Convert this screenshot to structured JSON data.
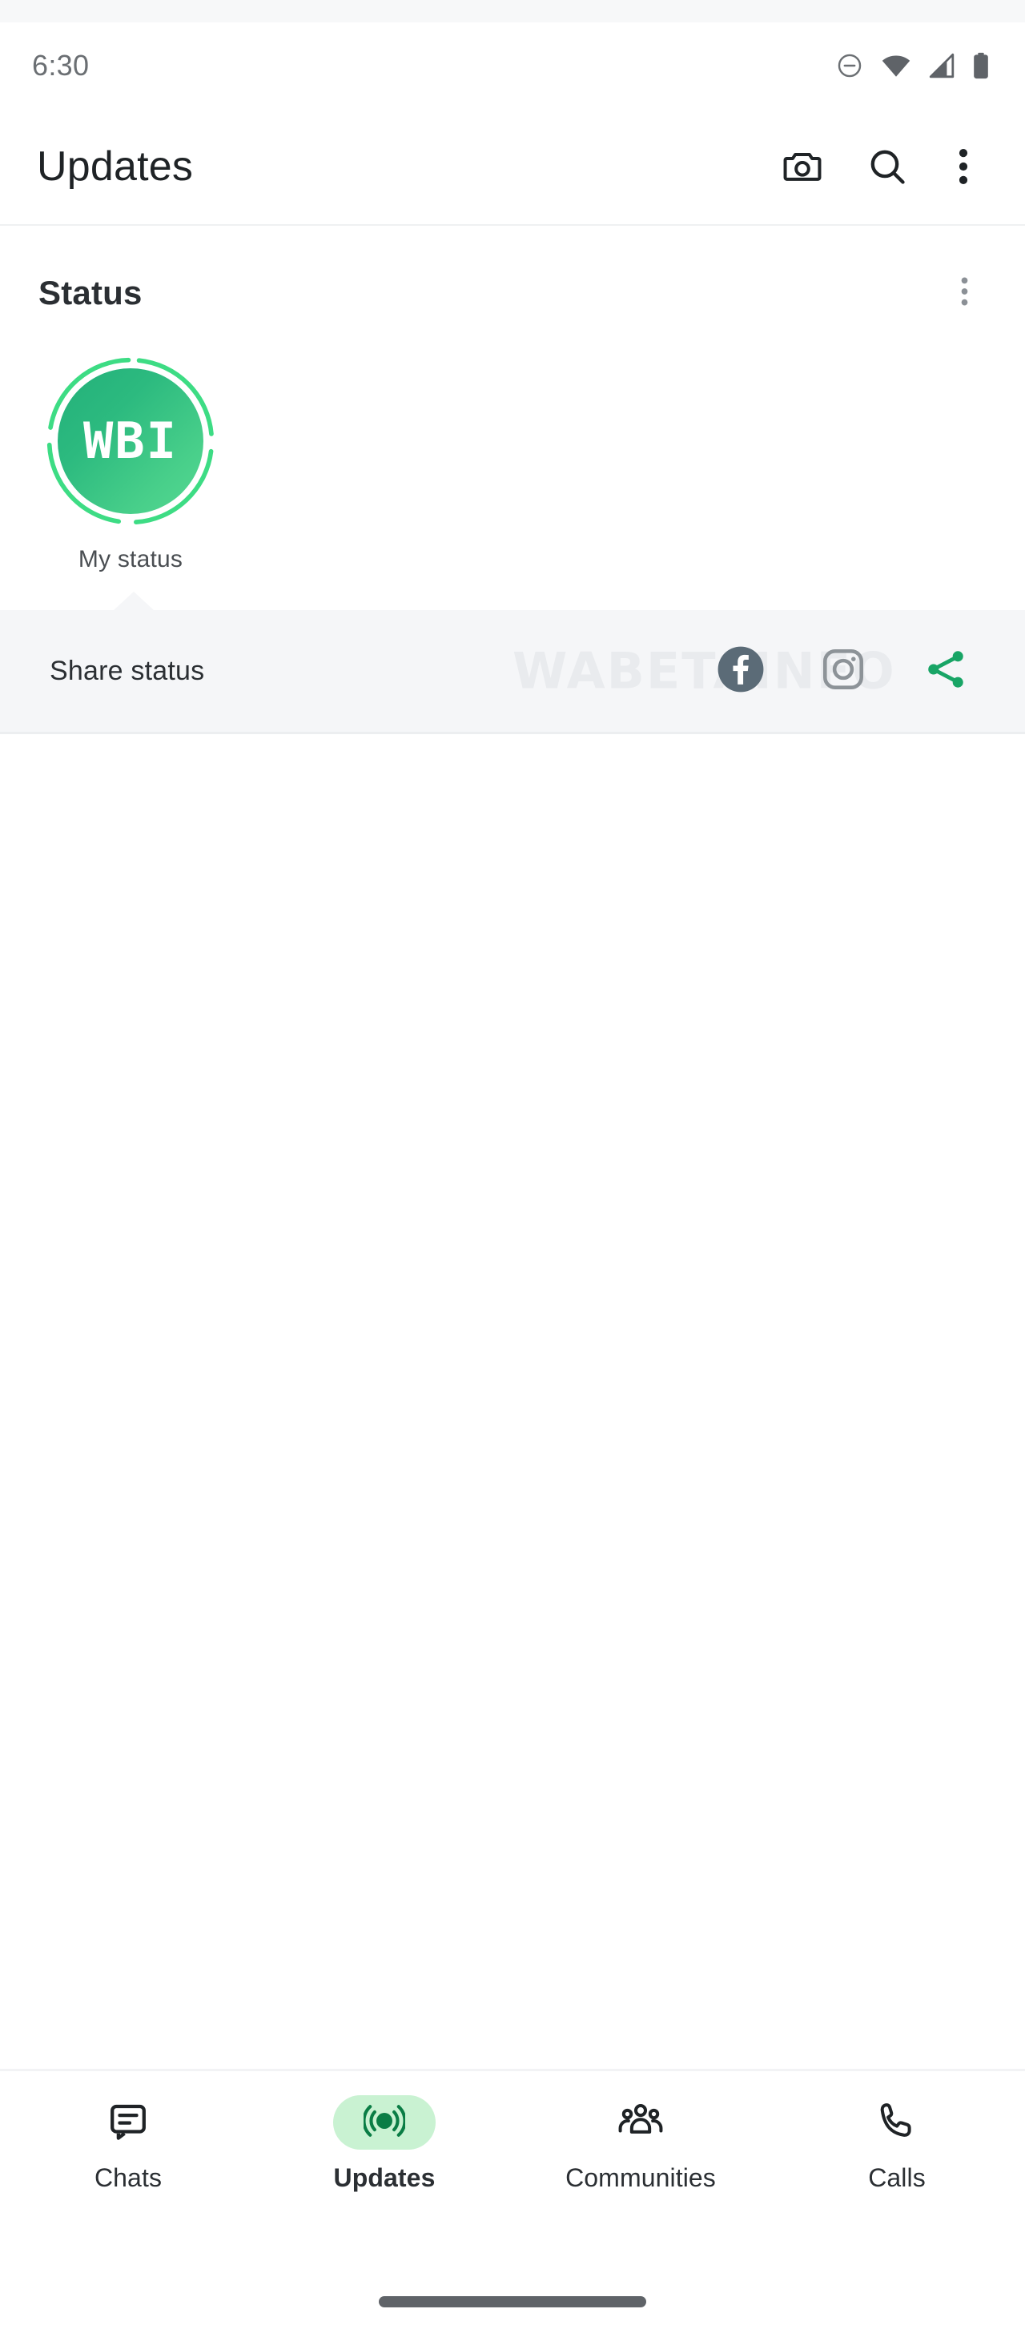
{
  "status_bar": {
    "time": "6:30",
    "icons": [
      "do-not-disturb-icon",
      "wifi-icon",
      "cellular-signal-icon",
      "battery-icon"
    ]
  },
  "header": {
    "title": "Updates",
    "actions": [
      {
        "name": "camera-icon",
        "label": "Camera"
      },
      {
        "name": "search-icon",
        "label": "Search"
      },
      {
        "name": "overflow-menu-icon",
        "label": "More options"
      }
    ]
  },
  "status_section": {
    "title": "Status",
    "more_icon": "overflow-menu-icon",
    "my_status": {
      "label": "My status",
      "avatar_text": "WBI",
      "avatar_gradient_from": "#23b07a",
      "avatar_gradient_to": "#55d992",
      "ring_color": "#3ddc84"
    }
  },
  "share_status": {
    "label": "Share status",
    "watermark": "WABETAINFO",
    "background": "#f5f6f8",
    "icons": [
      {
        "name": "facebook-icon",
        "label": "Facebook",
        "color": "#5b6b77"
      },
      {
        "name": "instagram-icon",
        "label": "Instagram",
        "color": "#8d9398"
      },
      {
        "name": "share-icon",
        "label": "Share",
        "color": "#18a566"
      }
    ]
  },
  "bottom_nav": {
    "active_pill_color": "#c9f2d2",
    "items": [
      {
        "label": "Chats",
        "icon": "chats-icon",
        "active": false
      },
      {
        "label": "Updates",
        "icon": "updates-status-icon",
        "active": true
      },
      {
        "label": "Communities",
        "icon": "communities-icon",
        "active": false
      },
      {
        "label": "Calls",
        "icon": "calls-phone-icon",
        "active": false
      }
    ]
  },
  "gesture_bar": {
    "name": "home-gesture-bar"
  }
}
